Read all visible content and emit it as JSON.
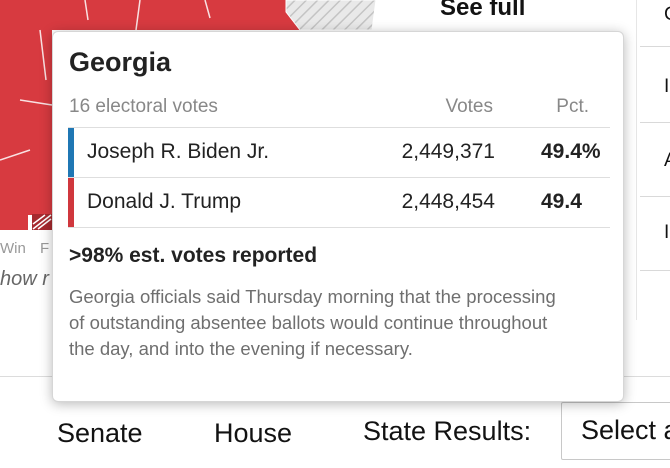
{
  "colors": {
    "republican": "#d0373d",
    "democrat": "#1f77b4",
    "map_background": "#d73a40",
    "hatch": "#bfbfbf"
  },
  "background": {
    "see_full_text": "See full",
    "legend": [
      "Win",
      "F"
    ],
    "show_text": "how r",
    "right_letters": [
      "C",
      "I",
      "A",
      "I"
    ]
  },
  "tooltip": {
    "state": "Georgia",
    "electoral_votes": "16 electoral votes",
    "col_votes": "Votes",
    "col_pct": "Pct.",
    "candidates": [
      {
        "name": "Joseph R. Biden Jr.",
        "votes": "2,449,371",
        "pct": "49.4%",
        "party": "democrat"
      },
      {
        "name": "Donald J. Trump",
        "votes": "2,448,454",
        "pct": "49.4",
        "party": "republican"
      }
    ],
    "reported": ">98% est. votes reported",
    "note": "Georgia officials said Thursday morning that the processing of outstanding absentee ballots would continue throughout the day, and into the evening if necessary."
  },
  "nav": {
    "senate": "Senate",
    "house": "House",
    "state_results_label": "State Results:",
    "state_select_value": "Select a"
  }
}
